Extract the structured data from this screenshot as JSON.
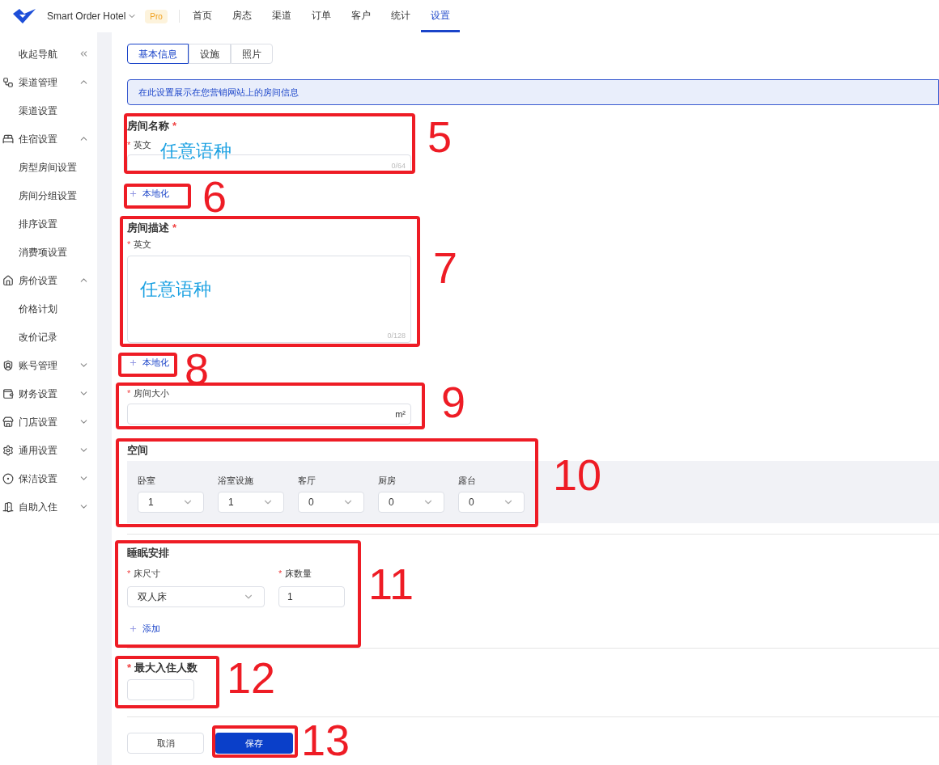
{
  "app": {
    "name": "Smart Order Hotel",
    "badge": "Pro"
  },
  "top_nav": [
    {
      "label": "首页",
      "selected": false
    },
    {
      "label": "房态",
      "selected": false
    },
    {
      "label": "渠道",
      "selected": false
    },
    {
      "label": "订单",
      "selected": false
    },
    {
      "label": "客户",
      "selected": false
    },
    {
      "label": "统计",
      "selected": false
    },
    {
      "label": "设置",
      "selected": true
    }
  ],
  "sidebar": {
    "collapse": "收起导航",
    "groups": [
      {
        "label": "渠道管理",
        "expanded": true,
        "children": [
          {
            "label": "渠道设置"
          }
        ]
      },
      {
        "label": "住宿设置",
        "expanded": true,
        "children": [
          {
            "label": "房型房间设置"
          },
          {
            "label": "房间分组设置"
          },
          {
            "label": "排序设置"
          },
          {
            "label": "消费项设置"
          }
        ]
      },
      {
        "label": "房价设置",
        "expanded": true,
        "children": [
          {
            "label": "价格计划"
          },
          {
            "label": "改价记录"
          }
        ]
      },
      {
        "label": "账号管理",
        "expanded": false
      },
      {
        "label": "财务设置",
        "expanded": false
      },
      {
        "label": "门店设置",
        "expanded": false
      },
      {
        "label": "通用设置",
        "expanded": false
      },
      {
        "label": "保洁设置",
        "expanded": false
      },
      {
        "label": "自助入住",
        "expanded": false
      }
    ]
  },
  "tabs": [
    {
      "label": "基本信息",
      "selected": true
    },
    {
      "label": "设施",
      "selected": false
    },
    {
      "label": "照片",
      "selected": false
    }
  ],
  "banner": "在此设置展示在您营销网站上的房间信息",
  "room_name": {
    "title": "房间名称",
    "title_mark": "*",
    "field_label": "英文",
    "field_mark": "*",
    "counter": "0/64",
    "link": "本地化"
  },
  "room_description": {
    "title": "房间描述",
    "title_mark": "*",
    "field_label": "英文",
    "field_mark": "*",
    "counter": "0/128",
    "link": "本地化"
  },
  "room_size": {
    "label": "房间大小",
    "mark": "*",
    "unit": "m²"
  },
  "space": {
    "title": "空间",
    "selects": [
      {
        "label": "卧室",
        "value": "1"
      },
      {
        "label": "浴室设施",
        "value": "1"
      },
      {
        "label": "客厅",
        "value": "0"
      },
      {
        "label": "厨房",
        "value": "0"
      },
      {
        "label": "露台",
        "value": "0"
      }
    ]
  },
  "sleeping": {
    "title": "睡眠安排",
    "bed_size": {
      "label": "床尺寸",
      "mark": "*",
      "value": "双人床"
    },
    "bed_count": {
      "label": "床数量",
      "mark": "*",
      "value": "1"
    },
    "add": "添加"
  },
  "max_guests": {
    "label": "最大入住人数",
    "mark": "*"
  },
  "buttons": {
    "cancel": "取消",
    "save": "保存"
  },
  "overlay_texts": [
    "任意语种",
    "任意语种"
  ],
  "annotations": [
    {
      "label": "5"
    },
    {
      "label": "6"
    },
    {
      "label": "7"
    },
    {
      "label": "8"
    },
    {
      "label": "9"
    },
    {
      "label": "10"
    },
    {
      "label": "11"
    },
    {
      "label": "12"
    },
    {
      "label": "13"
    }
  ]
}
